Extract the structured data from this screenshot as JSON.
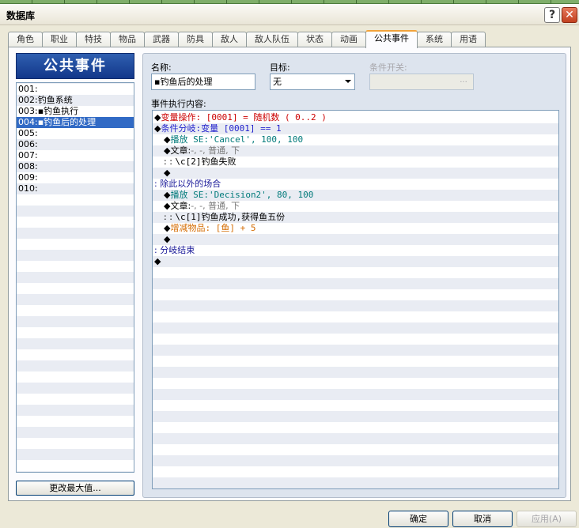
{
  "window": {
    "title": "数据库",
    "help_label": "?",
    "close_label": "✕"
  },
  "tabs": [
    {
      "label": "角色"
    },
    {
      "label": "职业"
    },
    {
      "label": "特技"
    },
    {
      "label": "物品"
    },
    {
      "label": "武器"
    },
    {
      "label": "防具"
    },
    {
      "label": "敌人"
    },
    {
      "label": "敌人队伍"
    },
    {
      "label": "状态"
    },
    {
      "label": "动画"
    },
    {
      "label": "公共事件",
      "active": true
    },
    {
      "label": "系统"
    },
    {
      "label": "用语"
    }
  ],
  "left_panel": {
    "header": "公共事件",
    "items": [
      {
        "label": "001:"
      },
      {
        "label": "002:钓鱼系统"
      },
      {
        "label": "003:▪钓鱼执行"
      },
      {
        "label": "004:▪钓鱼后的处理",
        "selected": true
      },
      {
        "label": "005:"
      },
      {
        "label": "006:"
      },
      {
        "label": "007:"
      },
      {
        "label": "008:"
      },
      {
        "label": "009:"
      },
      {
        "label": "010:"
      }
    ],
    "change_max_button": "更改最大值..."
  },
  "event": {
    "name_label": "名称:",
    "name_value": "▪钓鱼后的处理",
    "trigger_label": "目标:",
    "trigger_value": "无",
    "switch_label": "条件开关:",
    "switch_value": "",
    "switch_button": "...",
    "contents_label": "事件执行内容:"
  },
  "commands": [
    {
      "indent": 0,
      "parts": [
        {
          "text": "◆",
          "color": "black"
        },
        {
          "text": "变量操作: [0001] = 随机数 ( 0..2 )",
          "color": "red"
        }
      ]
    },
    {
      "indent": 0,
      "parts": [
        {
          "text": "◆",
          "color": "black"
        },
        {
          "text": "条件分岐:变量 [0001] == 1",
          "color": "blue"
        }
      ]
    },
    {
      "indent": 1,
      "parts": [
        {
          "text": "◆",
          "color": "black"
        },
        {
          "text": "播放 SE:'Cancel', 100, 100",
          "color": "teal"
        }
      ]
    },
    {
      "indent": 1,
      "parts": [
        {
          "text": "◆",
          "color": "black"
        },
        {
          "text": "文章:",
          "color": "black"
        },
        {
          "text": "-, -, 普通, 下",
          "color": "gray"
        }
      ]
    },
    {
      "indent": 1,
      "parts": [
        {
          "text": ":      : ",
          "color": "black"
        },
        {
          "text": "\\c[2]钓鱼失败",
          "color": "black"
        }
      ]
    },
    {
      "indent": 1,
      "parts": [
        {
          "text": "◆",
          "color": "black"
        }
      ]
    },
    {
      "indent": 0,
      "parts": [
        {
          "text": ": 除此以外的场合",
          "color": "navy"
        }
      ]
    },
    {
      "indent": 1,
      "parts": [
        {
          "text": "◆",
          "color": "black"
        },
        {
          "text": "播放 SE:'Decision2', 80, 100",
          "color": "teal"
        }
      ]
    },
    {
      "indent": 1,
      "parts": [
        {
          "text": "◆",
          "color": "black"
        },
        {
          "text": "文章:",
          "color": "black"
        },
        {
          "text": "-, -, 普通, 下",
          "color": "gray"
        }
      ]
    },
    {
      "indent": 1,
      "parts": [
        {
          "text": ":      : ",
          "color": "black"
        },
        {
          "text": "\\c[1]钓鱼成功,获得鱼五份",
          "color": "black"
        }
      ]
    },
    {
      "indent": 1,
      "parts": [
        {
          "text": "◆",
          "color": "black"
        },
        {
          "text": "增减物品: [鱼] + 5",
          "color": "orange"
        }
      ]
    },
    {
      "indent": 1,
      "parts": [
        {
          "text": "◆",
          "color": "black"
        }
      ]
    },
    {
      "indent": 0,
      "parts": [
        {
          "text": ": 分岐结束",
          "color": "navy"
        }
      ]
    },
    {
      "indent": 0,
      "parts": [
        {
          "text": "◆",
          "color": "black"
        }
      ]
    }
  ],
  "buttons": {
    "ok": "确定",
    "cancel": "取消",
    "apply": "应用(A)"
  },
  "colors": {
    "red": "#cc0000",
    "blue": "#1f1fcc",
    "teal": "#007a7a",
    "orange": "#d46b00",
    "navy": "#1a1a99",
    "gray": "#7a7a7a",
    "black": "#000000",
    "selection": "#316ac5",
    "header_blue": "#12378a",
    "active_tab": "#f2a33a"
  }
}
